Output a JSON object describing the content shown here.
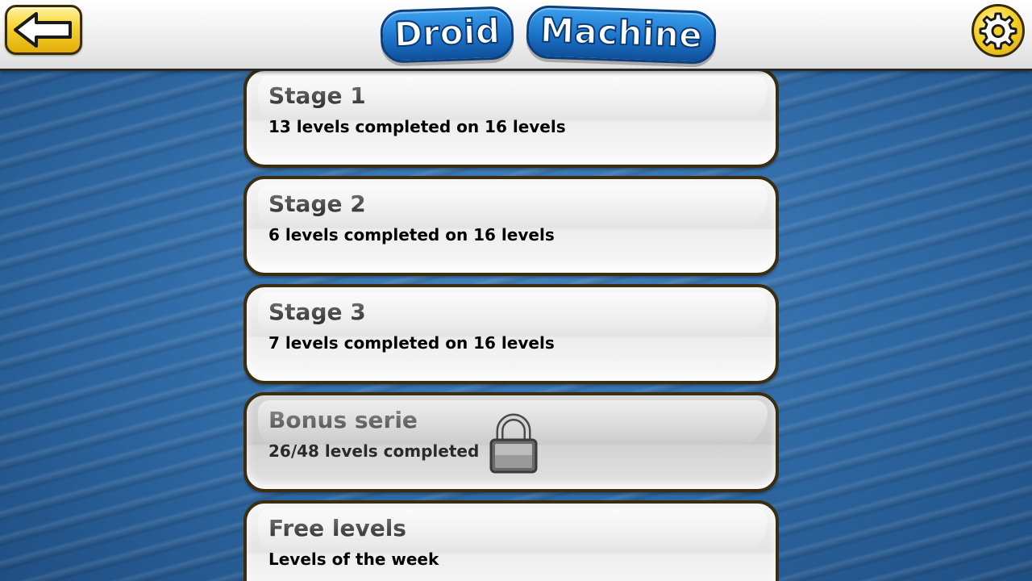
{
  "header": {
    "logo_word_1": "Droid",
    "logo_word_2": "Machine",
    "back_icon": "back-arrow-icon",
    "settings_icon": "gear-icon"
  },
  "colors": {
    "header_bg": "#f2f2f2",
    "button_yellow": "#f6d22a",
    "logo_blue": "#1a6fc4",
    "background_blue": "#2d66a0",
    "card_border": "#3b2d10"
  },
  "stages": [
    {
      "title": "Stage 1",
      "subtitle": "13 levels completed on 16 levels",
      "locked": false
    },
    {
      "title": "Stage 2",
      "subtitle": "6 levels completed on 16 levels",
      "locked": false
    },
    {
      "title": "Stage 3",
      "subtitle": "7 levels completed on 16 levels",
      "locked": false
    },
    {
      "title": "Bonus serie",
      "subtitle": "26/48 levels completed",
      "locked": true,
      "icon": "padlock-icon"
    },
    {
      "title": "Free levels",
      "subtitle": "Levels of the week",
      "locked": false
    }
  ]
}
